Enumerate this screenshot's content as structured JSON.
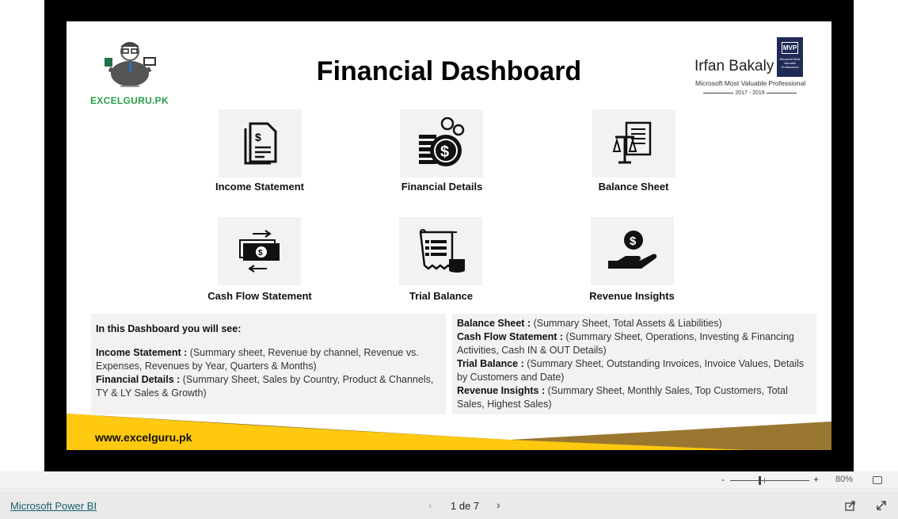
{
  "report": {
    "title": "Financial Dashboard",
    "logo_text": "EXCELGURU.PK",
    "author": {
      "name": "Irfan Bakaly",
      "badge": "MVP",
      "badge_sub": "Microsoft Most Valuable Professional",
      "subtitle": "Microsoft Most Valuable Professional",
      "years": "2017 - 2019"
    },
    "tiles": [
      {
        "label": "Income Statement",
        "icon": "document-dollar-icon"
      },
      {
        "label": "Financial Details",
        "icon": "coins-dollar-icon"
      },
      {
        "label": "Balance Sheet",
        "icon": "balance-scale-icon"
      },
      {
        "label": "Cash Flow Statement",
        "icon": "cash-exchange-icon"
      },
      {
        "label": "Trial Balance",
        "icon": "ledger-coins-icon"
      },
      {
        "label": "Revenue Insights",
        "icon": "hand-dollar-icon"
      }
    ],
    "left_panel": {
      "heading": "In this Dashboard you will see:",
      "items": [
        {
          "k": "Income Statement :",
          "v": " (Summary sheet, Revenue by channel, Revenue vs. Expenses, Revenues by Year, Quarters & Months)"
        },
        {
          "k": "Financial Details :",
          "v": " (Summary Sheet, Sales by Country, Product & Channels, TY & LY Sales & Growth)"
        }
      ]
    },
    "right_panel": {
      "items": [
        {
          "k": "Balance Sheet :",
          "v": " (Summary Sheet, Total Assets & Liabilities)"
        },
        {
          "k": "Cash Flow Statement :",
          "v": " (Summary Sheet, Operations, Investing & Financing Activities, Cash IN & OUT Details)"
        },
        {
          "k": "Trial Balance :",
          "v": " (Summary Sheet, Outstanding Invoices, Invoice Values, Details by Customers and Date)"
        },
        {
          "k": "Revenue Insights :",
          "v": " (Summary Sheet, Monthly Sales, Top Customers, Total Sales, Highest Sales)"
        }
      ]
    },
    "website": "www.excelguru.pk",
    "colors": {
      "yellow": "#fec90f",
      "brown": "#9a7730",
      "tile": "#f3f2f1"
    }
  },
  "viewer": {
    "zoom_minus": "-",
    "zoom_plus": "+",
    "zoom": "80%",
    "zoom_percent": 80,
    "brand_link": "Microsoft Power BI",
    "page_indicator": "1 de 7"
  }
}
